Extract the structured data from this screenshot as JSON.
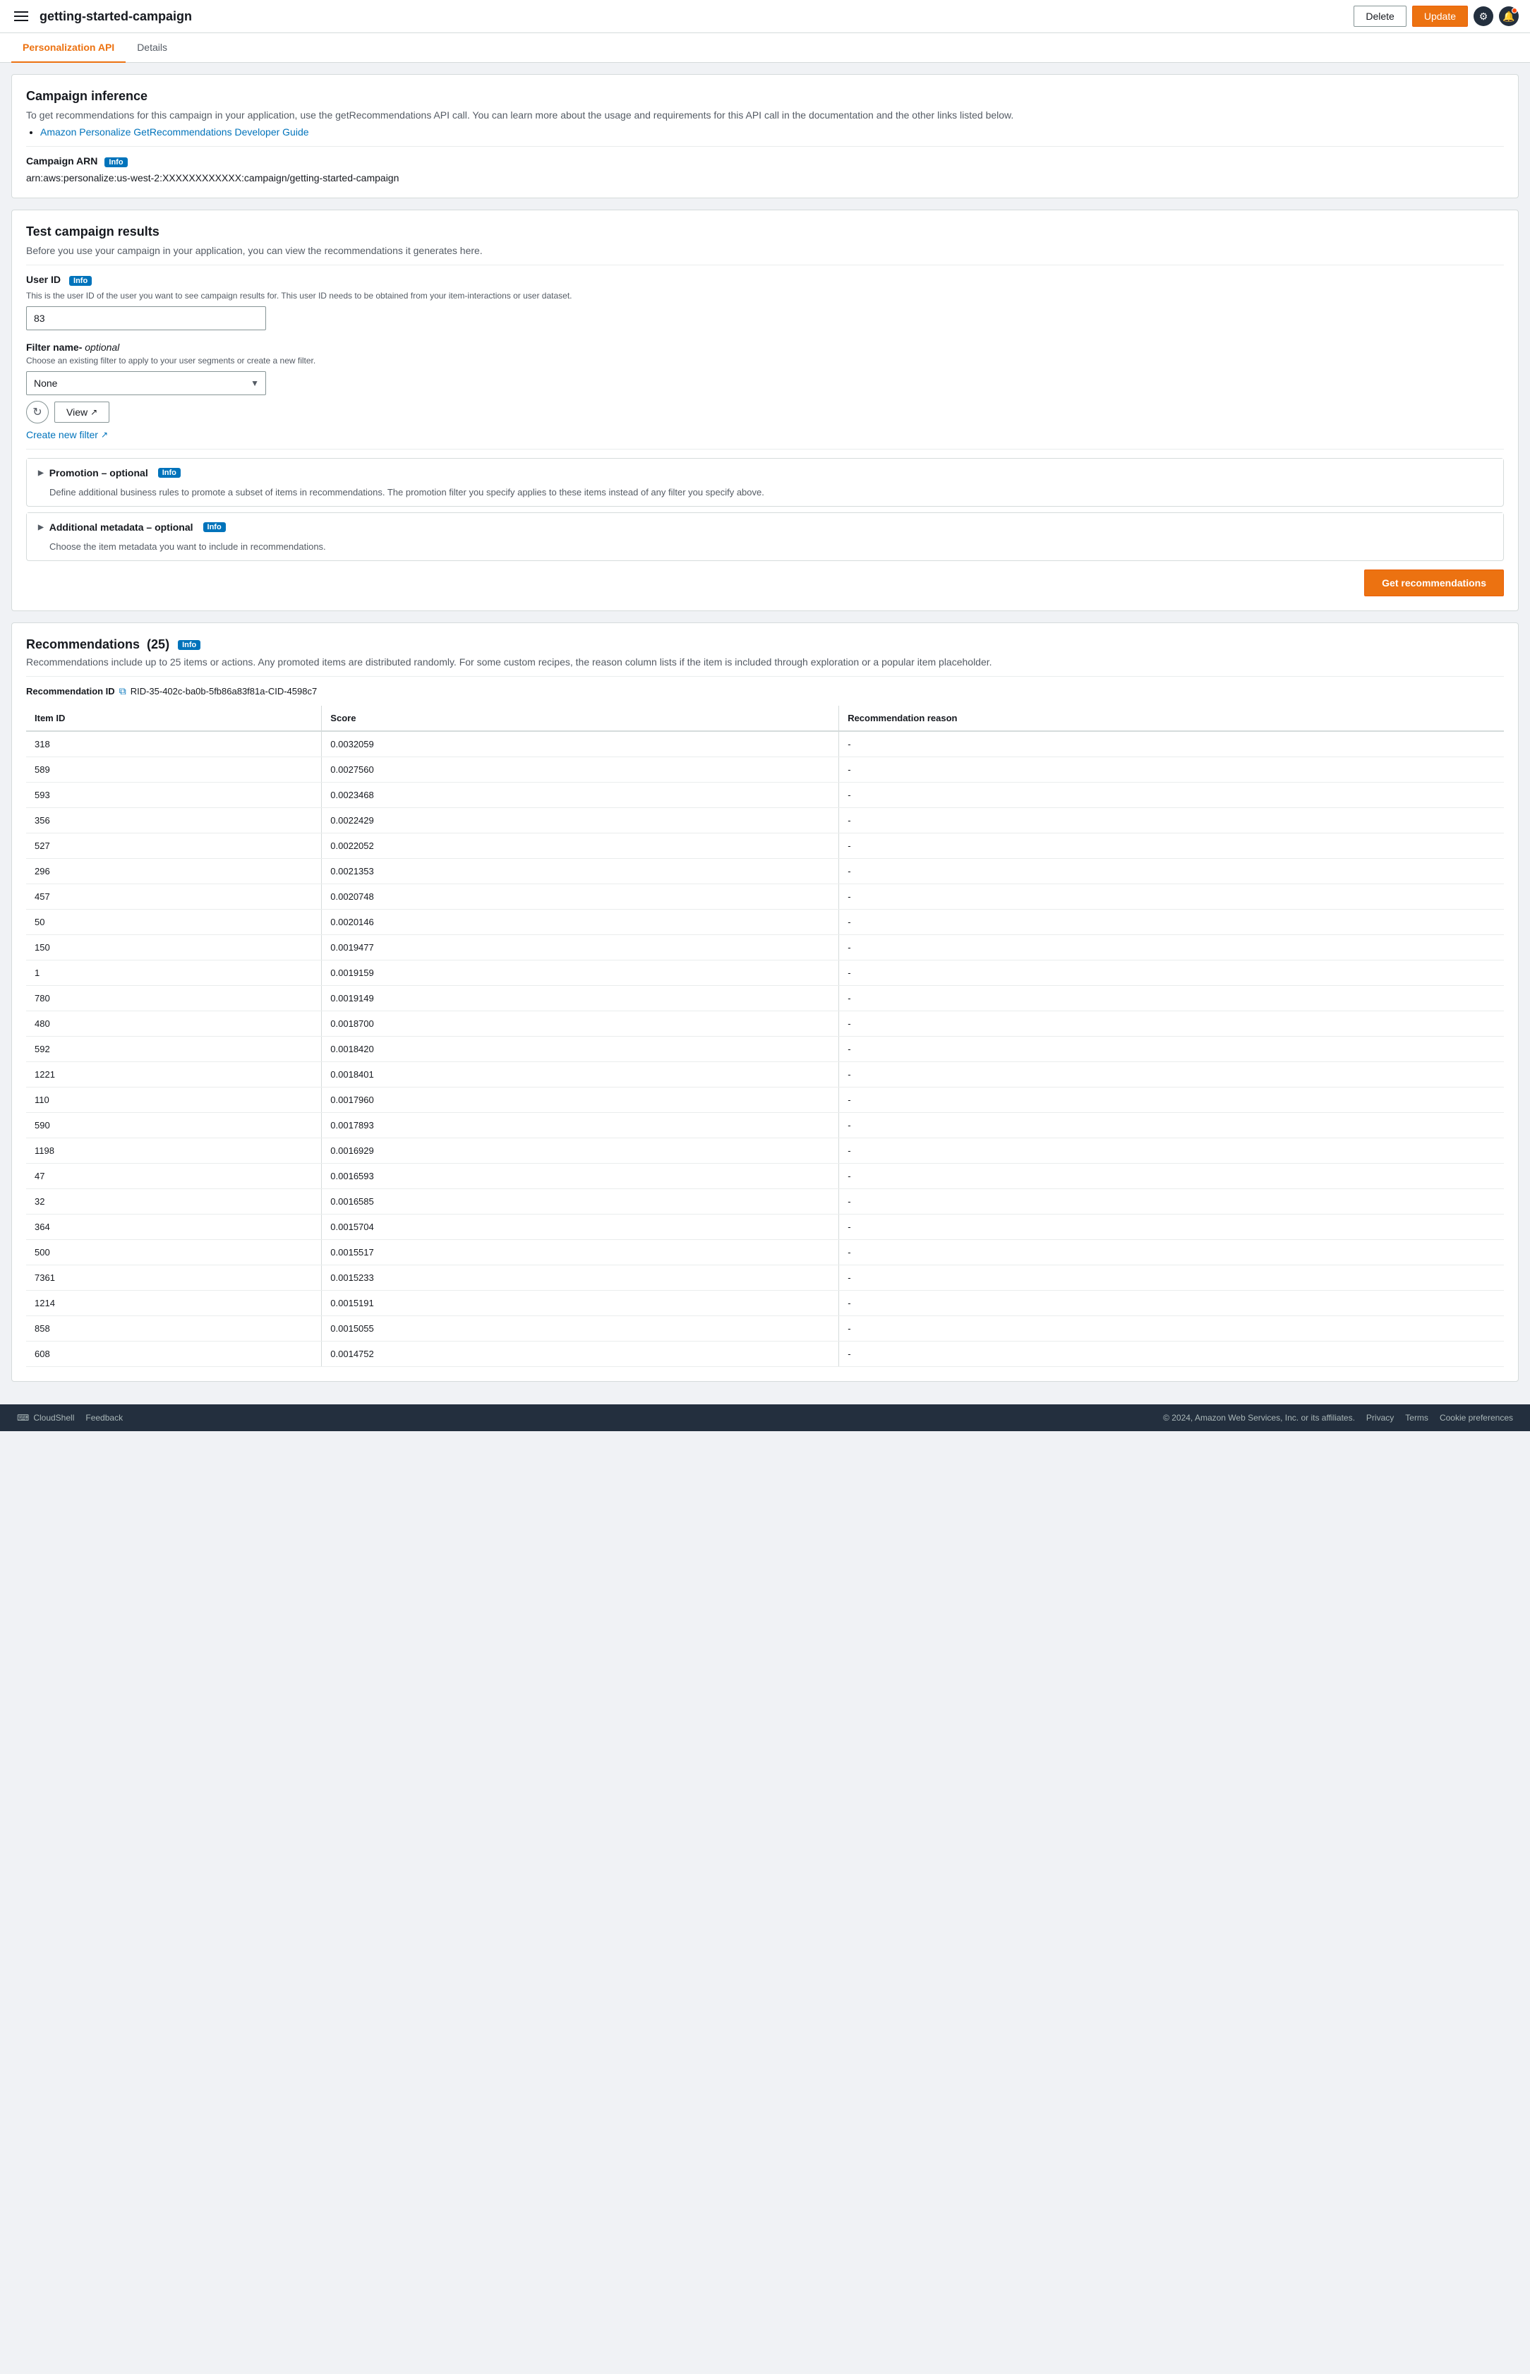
{
  "header": {
    "title": "getting-started-campaign",
    "delete_label": "Delete",
    "update_label": "Update"
  },
  "tabs": [
    {
      "label": "Personalization API",
      "active": true
    },
    {
      "label": "Details",
      "active": false
    }
  ],
  "campaign_inference": {
    "title": "Campaign inference",
    "description": "To get recommendations for this campaign in your application, use the getRecommendations API call. You can learn more about the usage and requirements for this API call in the documentation and the other links listed below.",
    "link_text": "Amazon Personalize GetRecommendations Developer Guide",
    "arn_label": "Campaign ARN",
    "arn_info": "Info",
    "arn_value": "arn:aws:personalize:us-west-2:XXXXXXXXXXXX:campaign/getting-started-campaign"
  },
  "test_campaign": {
    "title": "Test campaign results",
    "description": "Before you use your campaign in your application, you can view the recommendations it generates here.",
    "user_id_label": "User ID",
    "user_id_info": "Info",
    "user_id_desc": "This is the user ID of the user you want to see campaign results for. This user ID needs to be obtained from your item-interactions or user dataset.",
    "user_id_value": "83",
    "filter_label": "Filter name-",
    "filter_optional": "optional",
    "filter_desc": "Choose an existing filter to apply to your user segments or create a new filter.",
    "filter_value": "None",
    "filter_options": [
      "None"
    ],
    "view_label": "View",
    "create_filter_label": "Create new filter",
    "promotion_label": "Promotion",
    "promotion_optional": "optional",
    "promotion_info": "Info",
    "promotion_desc": "Define additional business rules to promote a subset of items in recommendations. The promotion filter you specify applies to these items instead of any filter you specify above.",
    "metadata_label": "Additional metadata",
    "metadata_optional": "optional",
    "metadata_info": "Info",
    "metadata_desc": "Choose the item metadata you want to include in recommendations.",
    "get_recs_label": "Get recommendations"
  },
  "recommendations": {
    "title": "Recommendations",
    "count": "(25)",
    "info": "Info",
    "desc": "Recommendations include up to 25 items or actions. Any promoted items are distributed randomly. For some custom recipes, the reason column lists if the item is included through exploration or a popular item placeholder.",
    "rec_id_label": "Recommendation ID",
    "rec_id_value": "RID-35-402c-ba0b-5fb86a83f81a-CID-4598c7",
    "columns": [
      "Item ID",
      "Score",
      "Recommendation reason"
    ],
    "rows": [
      {
        "item_id": "318",
        "score": "0.0032059",
        "reason": "-"
      },
      {
        "item_id": "589",
        "score": "0.0027560",
        "reason": "-"
      },
      {
        "item_id": "593",
        "score": "0.0023468",
        "reason": "-"
      },
      {
        "item_id": "356",
        "score": "0.0022429",
        "reason": "-"
      },
      {
        "item_id": "527",
        "score": "0.0022052",
        "reason": "-"
      },
      {
        "item_id": "296",
        "score": "0.0021353",
        "reason": "-"
      },
      {
        "item_id": "457",
        "score": "0.0020748",
        "reason": "-"
      },
      {
        "item_id": "50",
        "score": "0.0020146",
        "reason": "-"
      },
      {
        "item_id": "150",
        "score": "0.0019477",
        "reason": "-"
      },
      {
        "item_id": "1",
        "score": "0.0019159",
        "reason": "-"
      },
      {
        "item_id": "780",
        "score": "0.0019149",
        "reason": "-"
      },
      {
        "item_id": "480",
        "score": "0.0018700",
        "reason": "-"
      },
      {
        "item_id": "592",
        "score": "0.0018420",
        "reason": "-"
      },
      {
        "item_id": "1221",
        "score": "0.0018401",
        "reason": "-"
      },
      {
        "item_id": "110",
        "score": "0.0017960",
        "reason": "-"
      },
      {
        "item_id": "590",
        "score": "0.0017893",
        "reason": "-"
      },
      {
        "item_id": "1198",
        "score": "0.0016929",
        "reason": "-"
      },
      {
        "item_id": "47",
        "score": "0.0016593",
        "reason": "-"
      },
      {
        "item_id": "32",
        "score": "0.0016585",
        "reason": "-"
      },
      {
        "item_id": "364",
        "score": "0.0015704",
        "reason": "-"
      },
      {
        "item_id": "500",
        "score": "0.0015517",
        "reason": "-"
      },
      {
        "item_id": "7361",
        "score": "0.0015233",
        "reason": "-"
      },
      {
        "item_id": "1214",
        "score": "0.0015191",
        "reason": "-"
      },
      {
        "item_id": "858",
        "score": "0.0015055",
        "reason": "-"
      },
      {
        "item_id": "608",
        "score": "0.0014752",
        "reason": "-"
      }
    ]
  },
  "footer": {
    "cloudshell_label": "CloudShell",
    "feedback_label": "Feedback",
    "copyright": "© 2024, Amazon Web Services, Inc. or its affiliates.",
    "privacy_label": "Privacy",
    "terms_label": "Terms",
    "cookie_label": "Cookie preferences"
  }
}
